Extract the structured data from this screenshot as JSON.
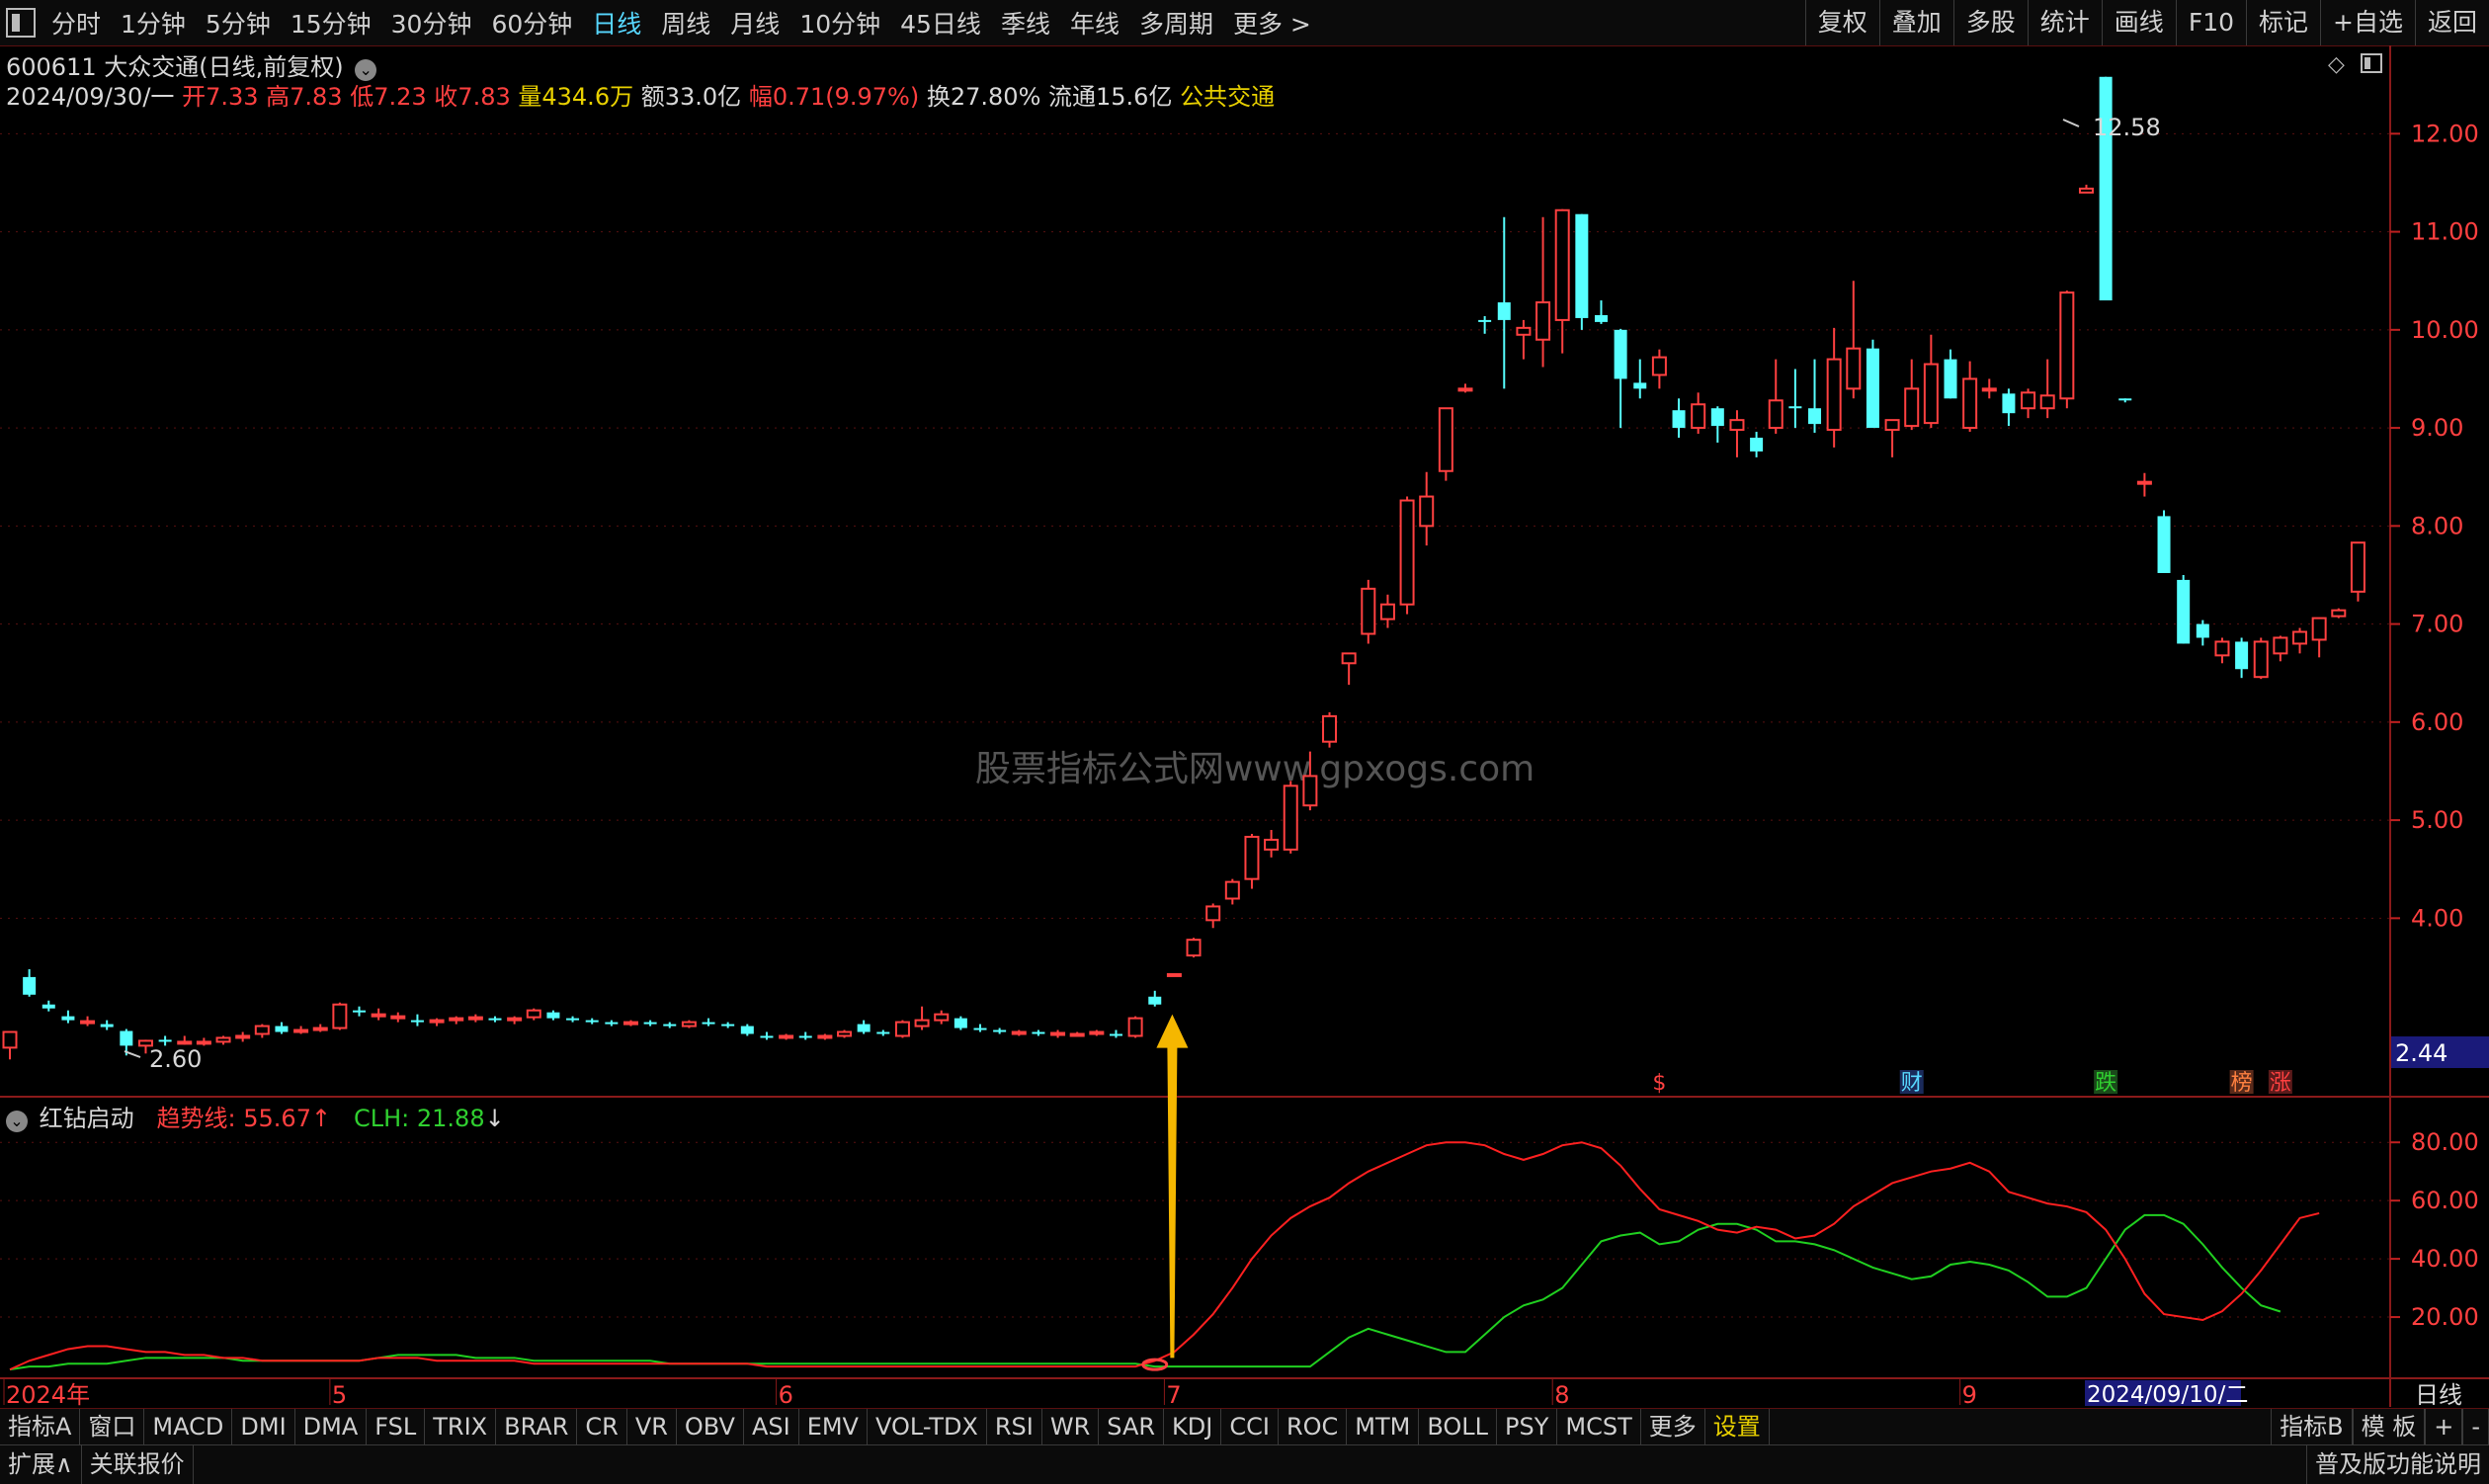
{
  "topbar": {
    "period_tabs": [
      "分时",
      "1分钟",
      "5分钟",
      "15分钟",
      "30分钟",
      "60分钟",
      "日线",
      "周线",
      "月线",
      "10分钟",
      "45日线",
      "季线",
      "年线",
      "多周期",
      "更多 >"
    ],
    "active_tab": "日线",
    "right_buttons": [
      "复权",
      "叠加",
      "多股",
      "统计",
      "画线",
      "F10",
      "标记",
      "+自选",
      "返回"
    ]
  },
  "stock": {
    "code_name": "600611 大众交通(日线,前复权)",
    "date": "2024/09/30/一",
    "open_label": "开",
    "open": "7.33",
    "high_label": "高",
    "high": "7.83",
    "low_label": "低",
    "low": "7.23",
    "close_label": "收",
    "close": "7.83",
    "volume_label": "量",
    "volume": "434.6万",
    "amount_label": "额",
    "amount": "33.0亿",
    "change_label": "幅",
    "change": "0.71(9.97%)",
    "turnover_label": "换",
    "turnover": "27.80%",
    "float_label": "流通",
    "float": "15.6亿",
    "sector": "公共交通"
  },
  "price_axis": {
    "ticks": [
      "12.00",
      "11.00",
      "10.00",
      "9.00",
      "8.00",
      "7.00",
      "6.00",
      "5.00",
      "4.00"
    ],
    "current_price_tag": "2.44",
    "max_label": "12.58",
    "min_label": "2.60"
  },
  "event_markers": [
    "$",
    "财",
    "跌",
    "榜",
    "涨"
  ],
  "watermark": "股票指标公式网www.gpxogs.com",
  "indicator": {
    "name": "红钻启动",
    "trend_label": "趋势线:",
    "trend_value": "55.67",
    "trend_arrow": "↑",
    "clh_label": "CLH:",
    "clh_value": "21.88",
    "clh_arrow": "↓",
    "ticks": [
      "80.00",
      "60.00",
      "40.00",
      "20.00"
    ]
  },
  "time_axis": {
    "labels": [
      "2024年",
      "5",
      "6",
      "7",
      "8",
      "9"
    ],
    "cursor_date": "2024/09/10/二",
    "period": "日线"
  },
  "bottom_tabs": [
    "指标A",
    "窗口",
    "MACD",
    "DMI",
    "DMA",
    "FSL",
    "TRIX",
    "BRAR",
    "CR",
    "VR",
    "OBV",
    "ASI",
    "EMV",
    "VOL-TDX",
    "RSI",
    "WR",
    "SAR",
    "KDJ",
    "CCI",
    "ROC",
    "MTM",
    "BOLL",
    "PSY",
    "MCST",
    "更多",
    "设置"
  ],
  "bottom_right_tabs": [
    "指标B",
    "模 板",
    "+",
    "-"
  ],
  "status_bar": {
    "expand": "扩展∧",
    "linked": "关联报价",
    "right_text": "普及版功能说明"
  },
  "colors": {
    "up": "#ff4040",
    "down": "#57ffff",
    "trend_line": "#ff2020",
    "clh_line": "#20d020",
    "arrow": "#f5b700",
    "grid": "#5a1010"
  },
  "chart_data": {
    "type": "candlestick",
    "price_range": [
      2.2,
      12.9
    ],
    "indicator_range": [
      0,
      95
    ],
    "candles": [
      [
        2.68,
        2.84,
        2.56,
        2.84
      ],
      [
        3.4,
        3.48,
        3.2,
        3.22
      ],
      [
        3.12,
        3.16,
        3.05,
        3.08
      ],
      [
        3.0,
        3.06,
        2.93,
        2.96
      ],
      [
        2.94,
        3.0,
        2.9,
        2.95
      ],
      [
        2.92,
        2.96,
        2.86,
        2.89
      ],
      [
        2.85,
        2.87,
        2.6,
        2.7
      ],
      [
        2.7,
        2.76,
        2.62,
        2.75
      ],
      [
        2.76,
        2.8,
        2.7,
        2.75
      ],
      [
        2.74,
        2.8,
        2.71,
        2.74
      ],
      [
        2.73,
        2.78,
        2.7,
        2.74
      ],
      [
        2.74,
        2.8,
        2.71,
        2.78
      ],
      [
        2.78,
        2.84,
        2.74,
        2.8
      ],
      [
        2.82,
        2.92,
        2.78,
        2.9
      ],
      [
        2.9,
        2.94,
        2.82,
        2.84
      ],
      [
        2.84,
        2.9,
        2.82,
        2.86
      ],
      [
        2.86,
        2.92,
        2.84,
        2.88
      ],
      [
        2.88,
        3.14,
        2.86,
        3.12
      ],
      [
        3.06,
        3.1,
        3.0,
        3.04
      ],
      [
        3.0,
        3.08,
        2.96,
        3.02
      ],
      [
        3.0,
        3.04,
        2.94,
        3.0
      ],
      [
        2.96,
        3.02,
        2.9,
        2.94
      ],
      [
        2.94,
        2.98,
        2.9,
        2.96
      ],
      [
        2.96,
        3.0,
        2.92,
        2.98
      ],
      [
        2.97,
        3.02,
        2.94,
        2.99
      ],
      [
        2.98,
        3.0,
        2.94,
        2.96
      ],
      [
        2.96,
        3.0,
        2.92,
        2.98
      ],
      [
        2.99,
        3.08,
        2.96,
        3.06
      ],
      [
        3.04,
        3.06,
        2.96,
        2.98
      ],
      [
        2.98,
        3.0,
        2.94,
        2.96
      ],
      [
        2.96,
        2.98,
        2.92,
        2.94
      ],
      [
        2.94,
        2.96,
        2.9,
        2.92
      ],
      [
        2.92,
        2.96,
        2.9,
        2.94
      ],
      [
        2.94,
        2.96,
        2.9,
        2.92
      ],
      [
        2.92,
        2.94,
        2.88,
        2.9
      ],
      [
        2.9,
        2.96,
        2.88,
        2.94
      ],
      [
        2.94,
        2.98,
        2.9,
        2.92
      ],
      [
        2.92,
        2.94,
        2.88,
        2.9
      ],
      [
        2.9,
        2.92,
        2.8,
        2.82
      ],
      [
        2.8,
        2.84,
        2.76,
        2.78
      ],
      [
        2.78,
        2.82,
        2.76,
        2.8
      ],
      [
        2.8,
        2.84,
        2.76,
        2.78
      ],
      [
        2.78,
        2.82,
        2.76,
        2.8
      ],
      [
        2.8,
        2.86,
        2.78,
        2.84
      ],
      [
        2.92,
        2.96,
        2.82,
        2.84
      ],
      [
        2.84,
        2.86,
        2.8,
        2.82
      ],
      [
        2.8,
        2.96,
        2.78,
        2.94
      ],
      [
        2.9,
        3.1,
        2.86,
        2.96
      ],
      [
        2.96,
        3.06,
        2.92,
        3.02
      ],
      [
        2.98,
        3.0,
        2.86,
        2.88
      ],
      [
        2.88,
        2.92,
        2.84,
        2.86
      ],
      [
        2.86,
        2.88,
        2.82,
        2.85
      ],
      [
        2.84,
        2.86,
        2.8,
        2.84
      ],
      [
        2.84,
        2.86,
        2.8,
        2.82
      ],
      [
        2.82,
        2.86,
        2.78,
        2.83
      ],
      [
        2.82,
        2.84,
        2.8,
        2.82
      ],
      [
        2.82,
        2.86,
        2.8,
        2.84
      ],
      [
        2.82,
        2.86,
        2.78,
        2.8
      ],
      [
        2.8,
        3.0,
        2.78,
        2.98
      ],
      [
        3.2,
        3.26,
        3.1,
        3.12
      ],
      [
        3.43,
        3.43,
        3.43,
        3.43
      ],
      [
        3.62,
        3.8,
        3.6,
        3.78
      ],
      [
        3.98,
        4.15,
        3.9,
        4.12
      ],
      [
        4.2,
        4.4,
        4.14,
        4.37
      ],
      [
        4.4,
        4.86,
        4.3,
        4.83
      ],
      [
        4.7,
        4.9,
        4.62,
        4.8
      ],
      [
        4.7,
        5.4,
        4.66,
        5.35
      ],
      [
        5.15,
        5.7,
        5.1,
        5.45
      ],
      [
        5.8,
        6.1,
        5.74,
        6.06
      ],
      [
        6.6,
        6.7,
        6.38,
        6.7
      ],
      [
        6.9,
        7.45,
        6.8,
        7.36
      ],
      [
        7.05,
        7.3,
        6.96,
        7.2
      ],
      [
        7.2,
        8.3,
        7.1,
        8.26
      ],
      [
        8.0,
        8.55,
        7.8,
        8.3
      ],
      [
        8.56,
        9.15,
        8.46,
        9.2
      ],
      [
        9.4,
        9.45,
        9.36,
        9.4
      ],
      [
        10.1,
        10.14,
        9.96,
        10.08
      ],
      [
        10.28,
        11.15,
        9.4,
        10.1
      ],
      [
        9.95,
        10.1,
        9.7,
        10.02
      ],
      [
        9.9,
        11.15,
        9.62,
        10.28
      ],
      [
        10.1,
        11.23,
        9.76,
        11.22
      ],
      [
        11.18,
        11.18,
        10.0,
        10.12
      ],
      [
        10.15,
        10.3,
        10.06,
        10.08
      ],
      [
        10.0,
        10.01,
        9.0,
        9.5
      ],
      [
        9.46,
        9.7,
        9.3,
        9.4
      ],
      [
        9.54,
        9.8,
        9.4,
        9.72
      ],
      [
        9.18,
        9.3,
        8.9,
        9.0
      ],
      [
        9.0,
        9.36,
        8.94,
        9.24
      ],
      [
        9.2,
        9.22,
        8.85,
        9.02
      ],
      [
        8.98,
        9.18,
        8.7,
        9.08
      ],
      [
        8.9,
        8.96,
        8.7,
        8.76
      ],
      [
        9.0,
        9.7,
        8.94,
        9.28
      ],
      [
        9.22,
        9.6,
        9.0,
        9.2
      ],
      [
        9.2,
        9.7,
        8.95,
        9.04
      ],
      [
        8.98,
        10.02,
        8.8,
        9.7
      ],
      [
        9.4,
        10.5,
        9.3,
        9.81
      ],
      [
        9.81,
        9.9,
        9.3,
        9.0
      ],
      [
        8.98,
        9.04,
        8.7,
        9.08
      ],
      [
        9.02,
        9.7,
        8.98,
        9.4
      ],
      [
        9.05,
        9.95,
        9.0,
        9.65
      ],
      [
        9.7,
        9.8,
        9.3,
        9.3
      ],
      [
        9.0,
        9.68,
        8.96,
        9.5
      ],
      [
        9.4,
        9.5,
        9.3,
        9.4
      ],
      [
        9.35,
        9.4,
        9.02,
        9.15
      ],
      [
        9.2,
        9.4,
        9.1,
        9.36
      ],
      [
        9.2,
        9.7,
        9.1,
        9.33
      ],
      [
        9.3,
        10.4,
        9.2,
        10.38
      ],
      [
        11.4,
        11.48,
        11.4,
        11.44
      ],
      [
        12.58,
        12.58,
        10.3,
        10.3
      ],
      [
        9.3,
        9.3,
        9.26,
        9.28
      ],
      [
        8.45,
        8.54,
        8.3,
        8.45
      ],
      [
        8.1,
        8.16,
        7.52,
        7.52
      ],
      [
        7.45,
        7.5,
        6.8,
        6.8
      ],
      [
        7.0,
        7.04,
        6.78,
        6.86
      ],
      [
        6.68,
        6.86,
        6.6,
        6.82
      ],
      [
        6.82,
        6.86,
        6.45,
        6.54
      ],
      [
        6.46,
        6.86,
        6.44,
        6.82
      ],
      [
        6.7,
        6.88,
        6.62,
        6.86
      ],
      [
        6.8,
        6.96,
        6.7,
        6.92
      ],
      [
        6.84,
        7.06,
        6.66,
        7.06
      ],
      [
        7.08,
        7.16,
        7.06,
        7.14
      ],
      [
        7.33,
        7.83,
        7.23,
        7.83
      ]
    ],
    "trend_line": [
      2,
      5,
      7,
      9,
      10,
      10,
      9,
      8,
      8,
      7,
      7,
      6,
      6,
      5,
      5,
      5,
      5,
      5,
      5,
      6,
      6,
      6,
      5,
      5,
      5,
      5,
      5,
      4,
      4,
      4,
      4,
      4,
      4,
      4,
      4,
      4,
      4,
      4,
      4,
      3,
      3,
      3,
      3,
      3,
      3,
      3,
      3,
      3,
      3,
      3,
      3,
      3,
      3,
      3,
      3,
      3,
      3,
      3,
      3,
      5,
      8,
      14,
      21,
      30,
      40,
      48,
      54,
      58,
      61,
      66,
      70,
      73,
      76,
      79,
      80,
      80,
      79,
      76,
      74,
      76,
      79,
      80,
      78,
      72,
      64,
      57,
      55,
      53,
      50,
      49,
      51,
      50,
      47,
      48,
      52,
      58,
      62,
      66,
      68,
      70,
      71,
      73,
      70,
      63,
      61,
      59,
      58,
      56,
      50,
      40,
      28,
      21,
      20,
      19,
      22,
      28,
      36,
      45,
      54,
      55.67
    ],
    "clh_line": [
      2,
      3,
      3,
      4,
      4,
      4,
      5,
      6,
      6,
      6,
      6,
      6,
      5,
      5,
      5,
      5,
      5,
      5,
      5,
      6,
      7,
      7,
      7,
      7,
      6,
      6,
      6,
      5,
      5,
      5,
      5,
      5,
      5,
      5,
      4,
      4,
      4,
      4,
      4,
      4,
      4,
      4,
      4,
      4,
      4,
      4,
      4,
      4,
      4,
      4,
      4,
      4,
      4,
      4,
      4,
      4,
      4,
      4,
      4,
      3,
      3,
      3,
      3,
      3,
      3,
      3,
      3,
      3,
      8,
      13,
      16,
      14,
      12,
      10,
      8,
      8,
      14,
      20,
      24,
      26,
      30,
      38,
      46,
      48,
      49,
      45,
      46,
      50,
      52,
      52,
      50,
      46,
      46,
      45,
      43,
      40,
      37,
      35,
      33,
      34,
      38,
      39,
      38,
      36,
      32,
      27,
      27,
      30,
      40,
      50,
      55,
      55,
      52,
      45,
      37,
      30,
      24,
      21.88
    ]
  }
}
